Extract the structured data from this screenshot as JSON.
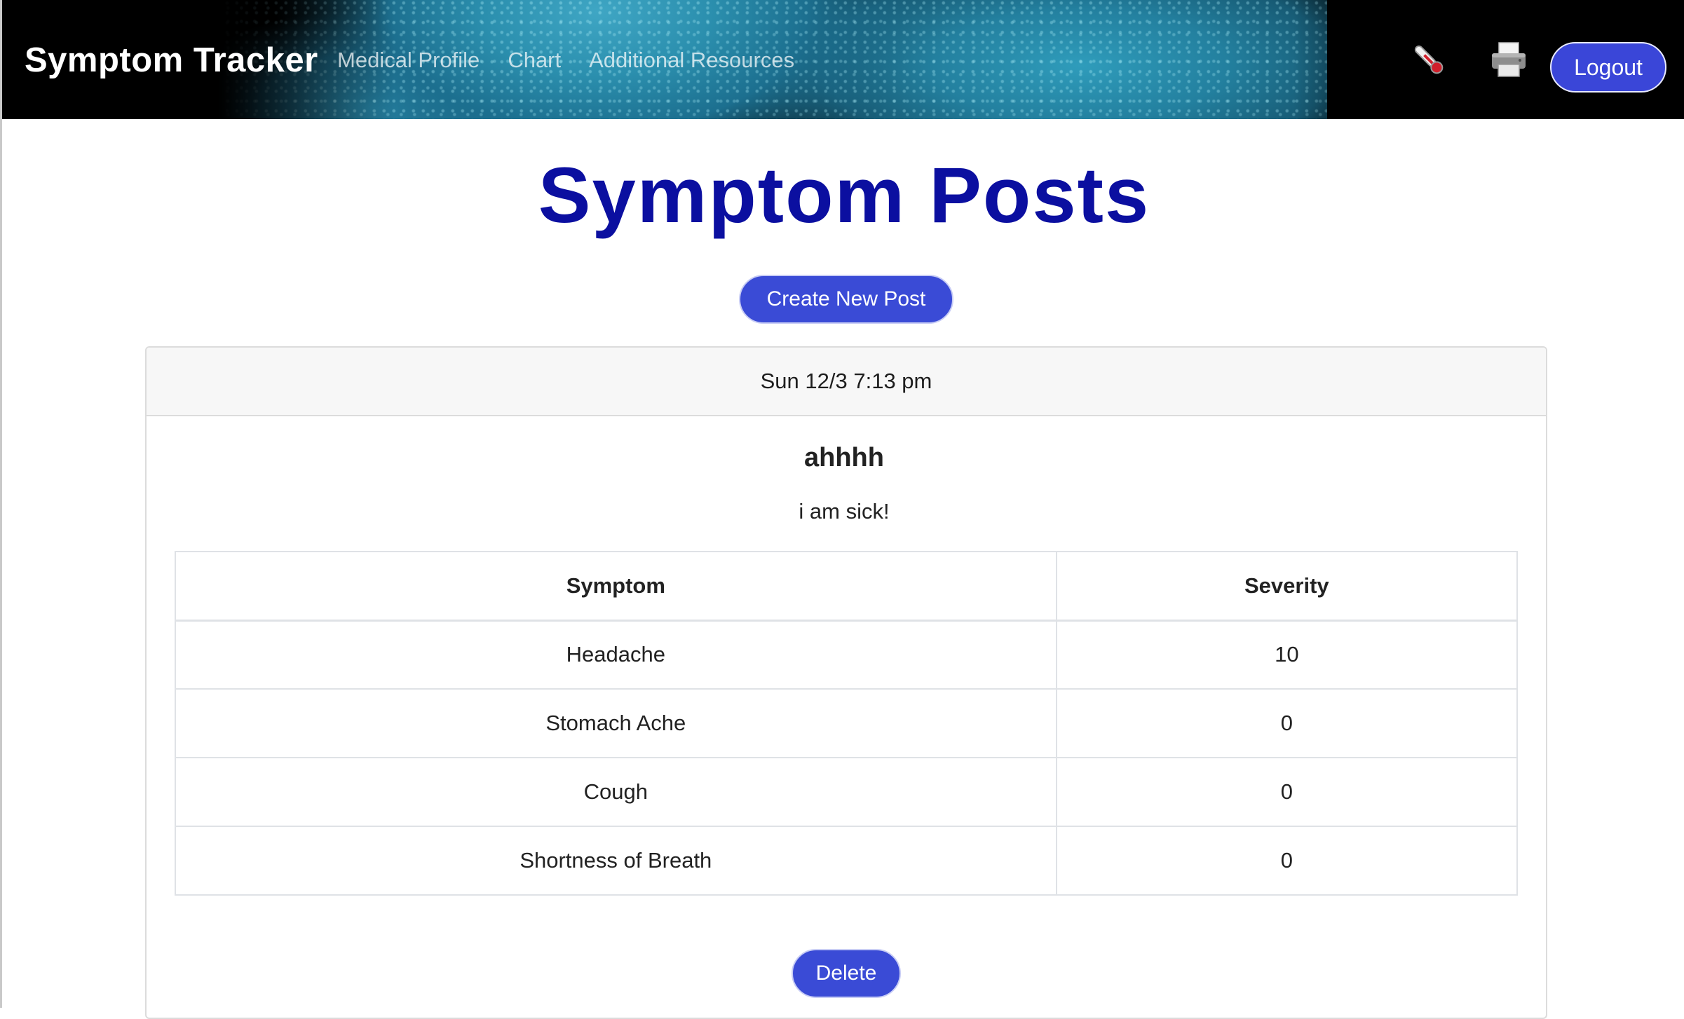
{
  "navbar": {
    "brand": "Symptom Tracker",
    "links": [
      {
        "label": "Medical Profile"
      },
      {
        "label": "Chart"
      },
      {
        "label": "Additional Resources"
      }
    ],
    "icons": {
      "thermometer": "thermometer-icon",
      "printer": "printer-icon"
    },
    "logout_label": "Logout"
  },
  "main": {
    "title": "Symptom Posts",
    "create_label": "Create New Post"
  },
  "post": {
    "timestamp": "Sun 12/3 7:13 pm",
    "title": "ahhhh",
    "body": "i am sick!",
    "table": {
      "headers": [
        "Symptom",
        "Severity"
      ],
      "rows": [
        [
          "Headache",
          "10"
        ],
        [
          "Stomach Ache",
          "0"
        ],
        [
          "Cough",
          "0"
        ],
        [
          "Shortness of Breath",
          "0"
        ]
      ]
    },
    "delete_label": "Delete"
  },
  "colors": {
    "title": "#0b0fa0",
    "button": "#3a4bd6",
    "navbar_bg": "#000000"
  }
}
